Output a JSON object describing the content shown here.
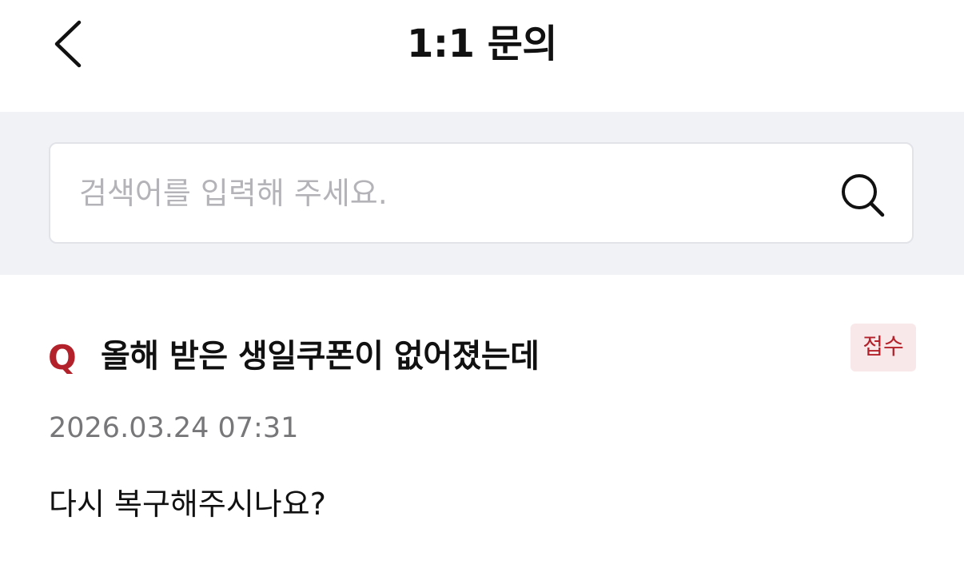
{
  "header": {
    "back_icon": "chevron-left-icon",
    "title": "1:1 문의"
  },
  "search": {
    "placeholder": "검색어를 입력해 주세요.",
    "value": "",
    "icon": "search-icon"
  },
  "inquiries": [
    {
      "marker": "Q",
      "title": "올해 받은 생일쿠폰이 없어졌는데",
      "status": "접수",
      "date": "2026.03.24 07:31",
      "body": "다시 복구해주시나요?"
    }
  ],
  "colors": {
    "accent": "#b3222a",
    "badge_bg": "#f8e8ea",
    "search_band_bg": "#f1f2f6",
    "date_text": "#77777a",
    "placeholder_text": "#b4b4b8"
  }
}
